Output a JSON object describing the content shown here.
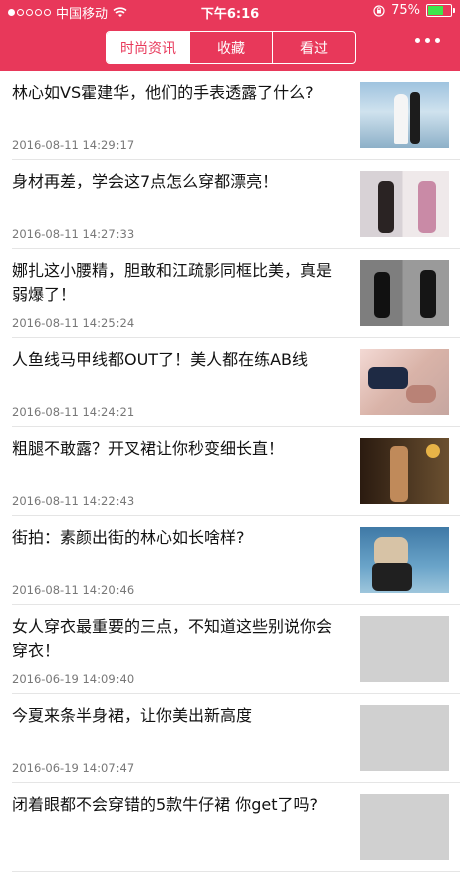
{
  "status_bar": {
    "carrier": "中国移动",
    "time": "下午6:16",
    "battery_text": "75%",
    "battery_level": 0.75,
    "signal_bars_filled": 1,
    "signal_bars_total": 5
  },
  "tabs": [
    {
      "label": "时尚资讯",
      "active": true
    },
    {
      "label": "收藏",
      "active": false
    },
    {
      "label": "看过",
      "active": false
    }
  ],
  "colors": {
    "accent": "#e8385a",
    "battery": "#3ee64b"
  },
  "articles": [
    {
      "title": "林心如VS霍建华，他们的手表透露了什么?",
      "date": "2016-08-11 14:29:17"
    },
    {
      "title": "身材再差，学会这7点怎么穿都漂亮！",
      "date": "2016-08-11 14:27:33"
    },
    {
      "title": "娜扎这小腰精，胆敢和江疏影同框比美，真是弱爆了！",
      "date": "2016-08-11 14:25:24"
    },
    {
      "title": "人鱼线马甲线都OUT了！美人都在练AB线",
      "date": "2016-08-11 14:24:21"
    },
    {
      "title": "粗腿不敢露？开叉裙让你秒变细长直！",
      "date": "2016-08-11 14:22:43"
    },
    {
      "title": "街拍：素颜出街的林心如长啥样?",
      "date": "2016-08-11 14:20:46"
    },
    {
      "title": "女人穿衣最重要的三点，不知道这些别说你会穿衣！",
      "date": "2016-06-19 14:09:40"
    },
    {
      "title": "今夏来条半身裙，让你美出新高度",
      "date": "2016-06-19 14:07:47"
    },
    {
      "title": "闭着眼都不会穿错的5款牛仔裙 你get了吗?",
      "date": ""
    }
  ]
}
